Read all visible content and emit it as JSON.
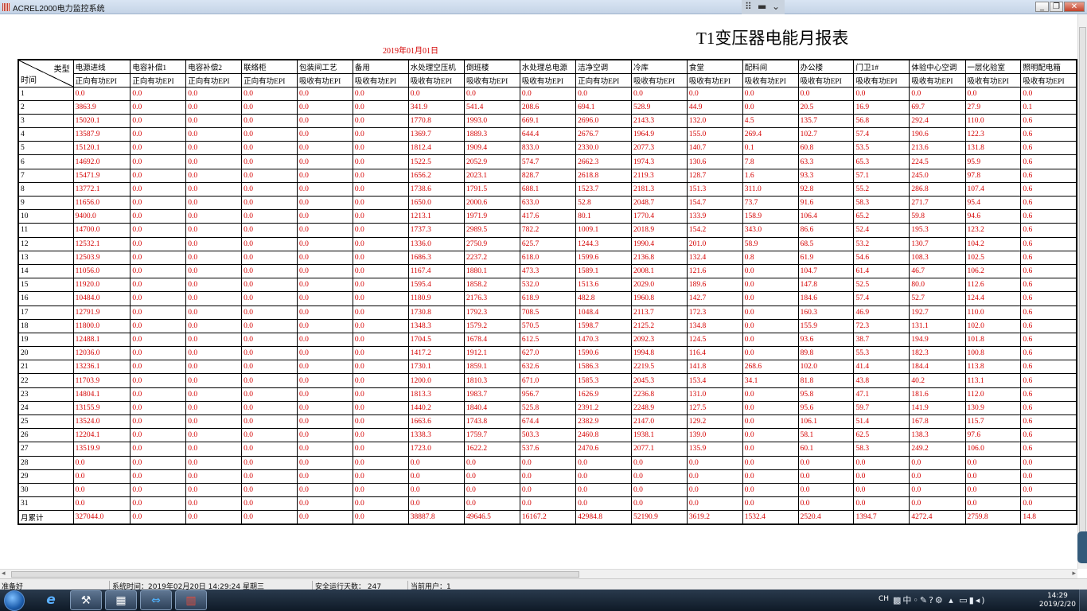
{
  "window": {
    "title": "ACREL2000电力监控系统",
    "buttons": [
      "minimize",
      "restore",
      "close"
    ]
  },
  "report": {
    "title": "T1变压器电能月报表",
    "date": "2019年01月01日",
    "corner_type": "类型",
    "corner_time": "时间",
    "total_label": "月累计",
    "columns": [
      {
        "name": "电源进线",
        "metric": "正向有功EPI"
      },
      {
        "name": "电容补偿1",
        "metric": "正向有功EPI"
      },
      {
        "name": "电容补偿2",
        "metric": "正向有功EPI"
      },
      {
        "name": "联络柜",
        "metric": "正向有功EPI"
      },
      {
        "name": "包装间工艺",
        "metric": "吸收有功EPI"
      },
      {
        "name": "备用",
        "metric": "吸收有功EPI"
      },
      {
        "name": "水处理空压机",
        "metric": "吸收有功EPI"
      },
      {
        "name": "倒班楼",
        "metric": "吸收有功EPI"
      },
      {
        "name": "水处理总电源",
        "metric": "吸收有功EPI"
      },
      {
        "name": "洁净空调",
        "metric": "正向有功EPI"
      },
      {
        "name": "冷库",
        "metric": "吸收有功EPI"
      },
      {
        "name": "食堂",
        "metric": "吸收有功EPI"
      },
      {
        "name": "配料间",
        "metric": "吸收有功EPI"
      },
      {
        "name": "办公楼",
        "metric": "吸收有功EPI"
      },
      {
        "name": "门卫1#",
        "metric": "吸收有功EPI"
      },
      {
        "name": "体验中心空调",
        "metric": "吸收有功EPI"
      },
      {
        "name": "一层化验室",
        "metric": "吸收有功EPI"
      },
      {
        "name": "照明配电箱",
        "metric": "吸收有功EPI"
      }
    ],
    "rows": [
      {
        "day": "1",
        "values": [
          "0.0",
          "0.0",
          "0.0",
          "0.0",
          "0.0",
          "0.0",
          "0.0",
          "0.0",
          "0.0",
          "0.0",
          "0.0",
          "0.0",
          "0.0",
          "0.0",
          "0.0",
          "0.0",
          "0.0",
          "0.0"
        ]
      },
      {
        "day": "2",
        "values": [
          "3863.9",
          "0.0",
          "0.0",
          "0.0",
          "0.0",
          "0.0",
          "341.9",
          "541.4",
          "208.6",
          "694.1",
          "528.9",
          "44.9",
          "0.0",
          "20.5",
          "16.9",
          "69.7",
          "27.9",
          "0.1"
        ]
      },
      {
        "day": "3",
        "values": [
          "15020.1",
          "0.0",
          "0.0",
          "0.0",
          "0.0",
          "0.0",
          "1770.8",
          "1993.0",
          "669.1",
          "2696.0",
          "2143.3",
          "132.0",
          "4.5",
          "135.7",
          "56.8",
          "292.4",
          "110.0",
          "0.6"
        ]
      },
      {
        "day": "4",
        "values": [
          "13587.9",
          "0.0",
          "0.0",
          "0.0",
          "0.0",
          "0.0",
          "1369.7",
          "1889.3",
          "644.4",
          "2676.7",
          "1964.9",
          "155.0",
          "269.4",
          "102.7",
          "57.4",
          "190.6",
          "122.3",
          "0.6"
        ]
      },
      {
        "day": "5",
        "values": [
          "15120.1",
          "0.0",
          "0.0",
          "0.0",
          "0.0",
          "0.0",
          "1812.4",
          "1909.4",
          "833.0",
          "2330.0",
          "2077.3",
          "140.7",
          "0.1",
          "60.8",
          "53.5",
          "213.6",
          "131.8",
          "0.6"
        ]
      },
      {
        "day": "6",
        "values": [
          "14692.0",
          "0.0",
          "0.0",
          "0.0",
          "0.0",
          "0.0",
          "1522.5",
          "2052.9",
          "574.7",
          "2662.3",
          "1974.3",
          "130.6",
          "7.8",
          "63.3",
          "65.3",
          "224.5",
          "95.9",
          "0.6"
        ]
      },
      {
        "day": "7",
        "values": [
          "15471.9",
          "0.0",
          "0.0",
          "0.0",
          "0.0",
          "0.0",
          "1656.2",
          "2023.1",
          "828.7",
          "2618.8",
          "2119.3",
          "128.7",
          "1.6",
          "93.3",
          "57.1",
          "245.0",
          "97.8",
          "0.6"
        ]
      },
      {
        "day": "8",
        "values": [
          "13772.1",
          "0.0",
          "0.0",
          "0.0",
          "0.0",
          "0.0",
          "1738.6",
          "1791.5",
          "688.1",
          "1523.7",
          "2181.3",
          "151.3",
          "311.0",
          "92.8",
          "55.2",
          "286.8",
          "107.4",
          "0.6"
        ]
      },
      {
        "day": "9",
        "values": [
          "11656.0",
          "0.0",
          "0.0",
          "0.0",
          "0.0",
          "0.0",
          "1650.0",
          "2000.6",
          "633.0",
          "52.8",
          "2048.7",
          "154.7",
          "73.7",
          "91.6",
          "58.3",
          "271.7",
          "95.4",
          "0.6"
        ]
      },
      {
        "day": "10",
        "values": [
          "9400.0",
          "0.0",
          "0.0",
          "0.0",
          "0.0",
          "0.0",
          "1213.1",
          "1971.9",
          "417.6",
          "80.1",
          "1770.4",
          "133.9",
          "158.9",
          "106.4",
          "65.2",
          "59.8",
          "94.6",
          "0.6"
        ]
      },
      {
        "day": "11",
        "values": [
          "14700.0",
          "0.0",
          "0.0",
          "0.0",
          "0.0",
          "0.0",
          "1737.3",
          "2989.5",
          "782.2",
          "1009.1",
          "2018.9",
          "154.2",
          "343.0",
          "86.6",
          "52.4",
          "195.3",
          "123.2",
          "0.6"
        ]
      },
      {
        "day": "12",
        "values": [
          "12532.1",
          "0.0",
          "0.0",
          "0.0",
          "0.0",
          "0.0",
          "1336.0",
          "2750.9",
          "625.7",
          "1244.3",
          "1990.4",
          "201.0",
          "58.9",
          "68.5",
          "53.2",
          "130.7",
          "104.2",
          "0.6"
        ]
      },
      {
        "day": "13",
        "values": [
          "12503.9",
          "0.0",
          "0.0",
          "0.0",
          "0.0",
          "0.0",
          "1686.3",
          "2237.2",
          "618.0",
          "1599.6",
          "2136.8",
          "132.4",
          "0.8",
          "61.9",
          "54.6",
          "108.3",
          "102.5",
          "0.6"
        ]
      },
      {
        "day": "14",
        "values": [
          "11056.0",
          "0.0",
          "0.0",
          "0.0",
          "0.0",
          "0.0",
          "1167.4",
          "1880.1",
          "473.3",
          "1589.1",
          "2008.1",
          "121.6",
          "0.0",
          "104.7",
          "61.4",
          "46.7",
          "106.2",
          "0.6"
        ]
      },
      {
        "day": "15",
        "values": [
          "11920.0",
          "0.0",
          "0.0",
          "0.0",
          "0.0",
          "0.0",
          "1595.4",
          "1858.2",
          "532.0",
          "1513.6",
          "2029.0",
          "189.6",
          "0.0",
          "147.8",
          "52.5",
          "80.0",
          "112.6",
          "0.6"
        ]
      },
      {
        "day": "16",
        "values": [
          "10484.0",
          "0.0",
          "0.0",
          "0.0",
          "0.0",
          "0.0",
          "1180.9",
          "2176.3",
          "618.9",
          "482.8",
          "1960.8",
          "142.7",
          "0.0",
          "184.6",
          "57.4",
          "52.7",
          "124.4",
          "0.6"
        ]
      },
      {
        "day": "17",
        "values": [
          "12791.9",
          "0.0",
          "0.0",
          "0.0",
          "0.0",
          "0.0",
          "1730.8",
          "1792.3",
          "708.5",
          "1048.4",
          "2113.7",
          "172.3",
          "0.0",
          "160.3",
          "46.9",
          "192.7",
          "110.0",
          "0.6"
        ]
      },
      {
        "day": "18",
        "values": [
          "11800.0",
          "0.0",
          "0.0",
          "0.0",
          "0.0",
          "0.0",
          "1348.3",
          "1579.2",
          "570.5",
          "1598.7",
          "2125.2",
          "134.8",
          "0.0",
          "155.9",
          "72.3",
          "131.1",
          "102.0",
          "0.6"
        ]
      },
      {
        "day": "19",
        "values": [
          "12488.1",
          "0.0",
          "0.0",
          "0.0",
          "0.0",
          "0.0",
          "1704.5",
          "1678.4",
          "612.5",
          "1470.3",
          "2092.3",
          "124.5",
          "0.0",
          "93.6",
          "38.7",
          "194.9",
          "101.8",
          "0.6"
        ]
      },
      {
        "day": "20",
        "values": [
          "12036.0",
          "0.0",
          "0.0",
          "0.0",
          "0.0",
          "0.0",
          "1417.2",
          "1912.1",
          "627.0",
          "1590.6",
          "1994.8",
          "116.4",
          "0.0",
          "89.8",
          "55.3",
          "182.3",
          "100.8",
          "0.6"
        ]
      },
      {
        "day": "21",
        "values": [
          "13236.1",
          "0.0",
          "0.0",
          "0.0",
          "0.0",
          "0.0",
          "1730.1",
          "1859.1",
          "632.6",
          "1586.3",
          "2219.5",
          "141.8",
          "268.6",
          "102.0",
          "41.4",
          "184.4",
          "113.8",
          "0.6"
        ]
      },
      {
        "day": "22",
        "values": [
          "11703.9",
          "0.0",
          "0.0",
          "0.0",
          "0.0",
          "0.0",
          "1200.0",
          "1810.3",
          "671.0",
          "1585.3",
          "2045.3",
          "153.4",
          "34.1",
          "81.8",
          "43.8",
          "40.2",
          "113.1",
          "0.6"
        ]
      },
      {
        "day": "23",
        "values": [
          "14804.1",
          "0.0",
          "0.0",
          "0.0",
          "0.0",
          "0.0",
          "1813.3",
          "1983.7",
          "956.7",
          "1626.9",
          "2236.8",
          "131.0",
          "0.0",
          "95.8",
          "47.1",
          "181.6",
          "112.0",
          "0.6"
        ]
      },
      {
        "day": "24",
        "values": [
          "13155.9",
          "0.0",
          "0.0",
          "0.0",
          "0.0",
          "0.0",
          "1440.2",
          "1840.4",
          "525.8",
          "2391.2",
          "2248.9",
          "127.5",
          "0.0",
          "95.6",
          "59.7",
          "141.9",
          "130.9",
          "0.6"
        ]
      },
      {
        "day": "25",
        "values": [
          "13524.0",
          "0.0",
          "0.0",
          "0.0",
          "0.0",
          "0.0",
          "1663.6",
          "1743.8",
          "674.4",
          "2382.9",
          "2147.0",
          "129.2",
          "0.0",
          "106.1",
          "51.4",
          "167.8",
          "115.7",
          "0.6"
        ]
      },
      {
        "day": "26",
        "values": [
          "12204.1",
          "0.0",
          "0.0",
          "0.0",
          "0.0",
          "0.0",
          "1338.3",
          "1759.7",
          "503.3",
          "2460.8",
          "1938.1",
          "139.0",
          "0.0",
          "58.1",
          "62.5",
          "138.3",
          "97.6",
          "0.6"
        ]
      },
      {
        "day": "27",
        "values": [
          "13519.9",
          "0.0",
          "0.0",
          "0.0",
          "0.0",
          "0.0",
          "1723.0",
          "1622.2",
          "537.6",
          "2470.6",
          "2077.1",
          "135.9",
          "0.0",
          "60.1",
          "58.3",
          "249.2",
          "106.0",
          "0.6"
        ]
      },
      {
        "day": "28",
        "values": [
          "0.0",
          "0.0",
          "0.0",
          "0.0",
          "0.0",
          "0.0",
          "0.0",
          "0.0",
          "0.0",
          "0.0",
          "0.0",
          "0.0",
          "0.0",
          "0.0",
          "0.0",
          "0.0",
          "0.0",
          "0.0"
        ]
      },
      {
        "day": "29",
        "values": [
          "0.0",
          "0.0",
          "0.0",
          "0.0",
          "0.0",
          "0.0",
          "0.0",
          "0.0",
          "0.0",
          "0.0",
          "0.0",
          "0.0",
          "0.0",
          "0.0",
          "0.0",
          "0.0",
          "0.0",
          "0.0"
        ]
      },
      {
        "day": "30",
        "values": [
          "0.0",
          "0.0",
          "0.0",
          "0.0",
          "0.0",
          "0.0",
          "0.0",
          "0.0",
          "0.0",
          "0.0",
          "0.0",
          "0.0",
          "0.0",
          "0.0",
          "0.0",
          "0.0",
          "0.0",
          "0.0"
        ]
      },
      {
        "day": "31",
        "values": [
          "0.0",
          "0.0",
          "0.0",
          "0.0",
          "0.0",
          "0.0",
          "0.0",
          "0.0",
          "0.0",
          "0.0",
          "0.0",
          "0.0",
          "0.0",
          "0.0",
          "0.0",
          "0.0",
          "0.0",
          "0.0"
        ]
      }
    ],
    "totals": [
      "327044.0",
      "0.0",
      "0.0",
      "0.0",
      "0.0",
      "0.0",
      "38887.8",
      "49646.5",
      "16167.2",
      "42984.8",
      "52190.9",
      "3619.2",
      "1532.4",
      "2520.4",
      "1394.7",
      "4272.4",
      "2759.8",
      "14.8"
    ]
  },
  "statusbar": {
    "ready": "准备好",
    "system_time": "系统时间：2019年02月20日  14:29:24   星期三",
    "safe_days": "安全运行天数：  247",
    "current_user": "当前用户：1"
  },
  "taskbar": {
    "ime": "CH",
    "clock_time": "14:29",
    "clock_date": "2019/2/20",
    "icons": [
      "windows-start-icon",
      "internet-explorer-icon",
      "tools-icon",
      "calculator-icon",
      "teamviewer-icon",
      "acrel-app-icon"
    ]
  },
  "colors": {
    "value_text": "#d40000",
    "titlebar": "#d3dfee",
    "taskbar": "#1c2a3a"
  }
}
